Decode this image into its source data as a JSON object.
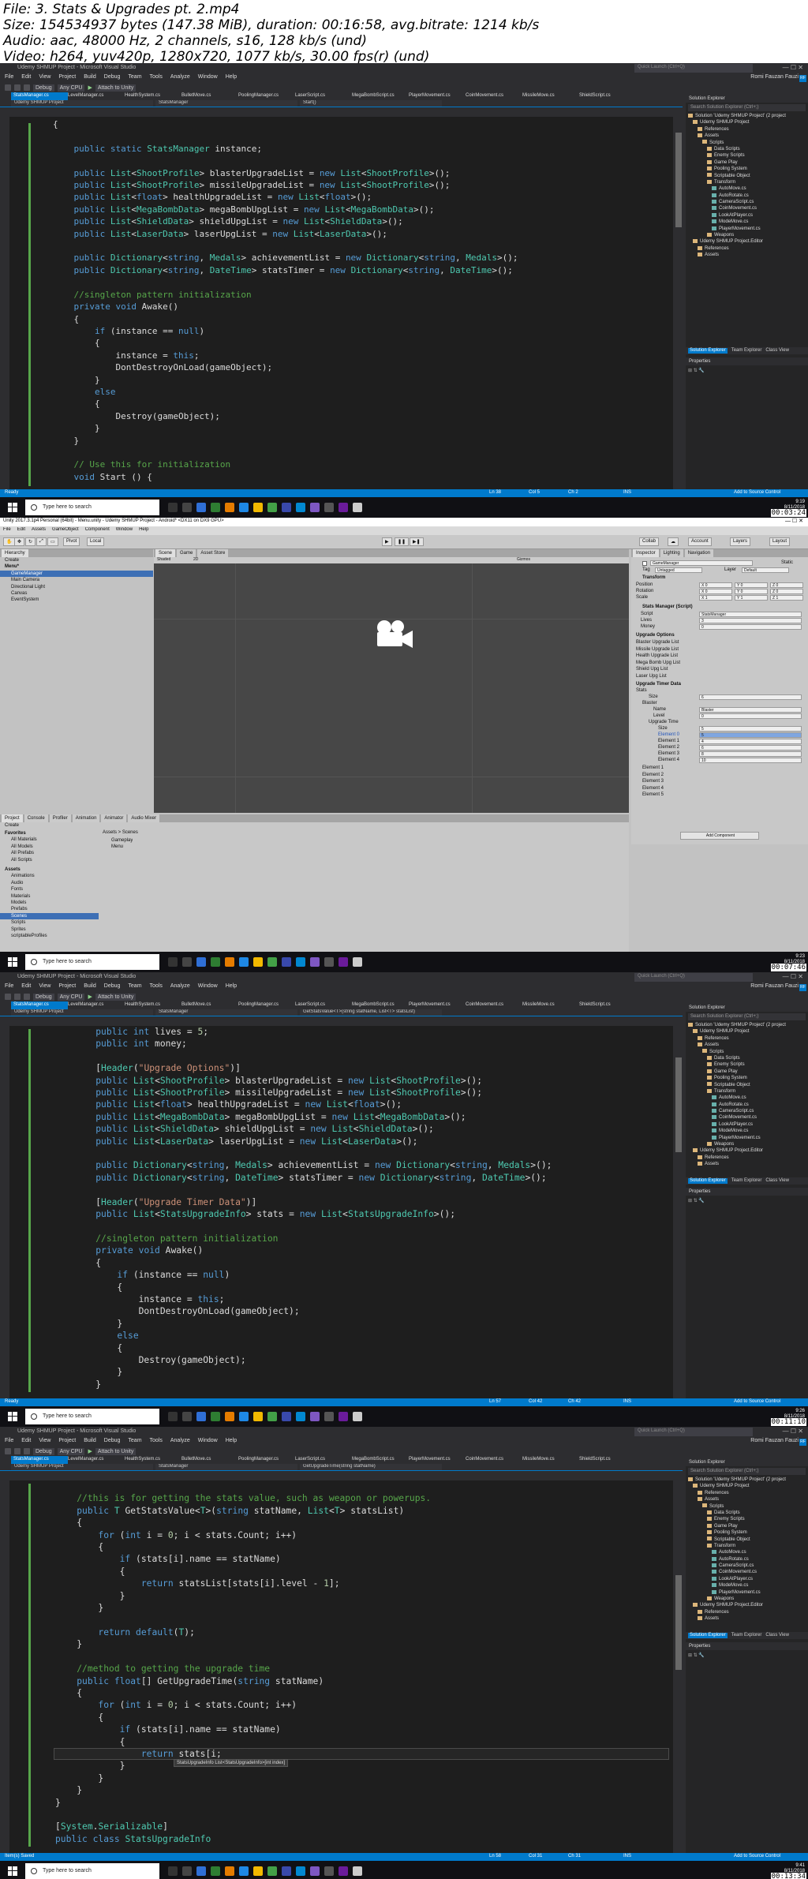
{
  "header": {
    "file": "File: 3. Stats & Upgrades pt. 2.mp4",
    "size": "Size: 154534937 bytes (147.38 MiB), duration: 00:16:58, avg.bitrate: 1214 kb/s",
    "audio": "Audio: aac, 48000 Hz, 2 channels, s16, 128 kb/s (und)",
    "video": "Video: h264, yuv420p, 1280x720, 1077 kb/s, 30.00 fps(r) (und)"
  },
  "vs": {
    "window_title": "Udemy SHMUP Project - Microsoft Visual Studio",
    "quick_launch": "Quick Launch (Ctrl+Q)",
    "user": "Romi Fauzan Fauzi",
    "user_initials": "RF",
    "menu": [
      "File",
      "Edit",
      "View",
      "Project",
      "Build",
      "Debug",
      "Team",
      "Tools",
      "Analyze",
      "Window",
      "Help"
    ],
    "toolbar": {
      "config": "Debug",
      "platform": "Any CPU",
      "attach": "Attach to Unity"
    },
    "tabs": [
      "StatsManager.cs",
      "LevelManager.cs",
      "HealthSystem.cs",
      "BulletMove.cs",
      "PoolingManager.cs",
      "LaserScript.cs",
      "MegaBombScript.cs",
      "PlayerMovement.cs",
      "CoinMovement.cs",
      "MissileMove.cs",
      "ShieldScript.cs"
    ],
    "nav_project": "Udemy SHMUP Project",
    "nav_class": "StatsManager",
    "solution": {
      "title": "Solution Explorer",
      "search": "Search Solution Explorer (Ctrl+;)",
      "items": [
        "Solution 'Udemy SHMUP Project' (2 project",
        "Udemy SHMUP Project",
        "References",
        "Assets",
        "Scripts",
        "Data Scripts",
        "Enemy Scripts",
        "Game Play",
        "Pooling System",
        "Scriptable Object",
        "Transform",
        "AutoMove.cs",
        "AutoRotate.cs",
        "CameraScript.cs",
        "CoinMovement.cs",
        "LookAtPlayer.cs",
        "ModeMove.cs",
        "PlayerMovement.cs",
        "Weapons",
        "Udemy SHMUP Project.Editor",
        "References",
        "Assets"
      ],
      "bottom_tabs": [
        "Solution Explorer",
        "Team Explorer",
        "Class View"
      ],
      "properties": "Properties"
    },
    "status_ready": "Ready",
    "status_add": "Add to Source Control"
  },
  "frame1": {
    "status": {
      "ln": "Ln 38",
      "col": "Col 5",
      "ch": "Ch 2",
      "ins": "INS",
      "zoom": "173 %"
    },
    "nav_member": "Start()",
    "lines": [
      "{",
      "",
      "    public static StatsManager instance;",
      "",
      "    public List<ShootProfile> blasterUpgradeList = new List<ShootProfile>();",
      "    public List<ShootProfile> missileUpgradeList = new List<ShootProfile>();",
      "    public List<float> healthUpgradeList = new List<float>();",
      "    public List<MegaBombData> megaBombUpgList = new List<MegaBombData>();",
      "    public List<ShieldData> shieldUpgList = new List<ShieldData>();",
      "    public List<LaserData> laserUpgList = new List<LaserData>();",
      "",
      "    public Dictionary<string, Medals> achievementList = new Dictionary<string, Medals>();",
      "    public Dictionary<string, DateTime> statsTimer = new Dictionary<string, DateTime>();",
      "",
      "    //singleton pattern initialization",
      "    private void Awake()",
      "    {",
      "        if (instance == null)",
      "        {",
      "            instance = this;",
      "            DontDestroyOnLoad(gameObject);",
      "        }",
      "        else",
      "        {",
      "            Destroy(gameObject);",
      "        }",
      "    }",
      "",
      "    // Use this for initialization",
      "    void Start () {"
    ],
    "stamp": "00:03:24",
    "clock": "9:19\n8/11/2018"
  },
  "unity": {
    "title": "Unity 2017.3.1p4 Personal (64bit) - Menu.unity - Udemy SHMUP Project - Android* <DX11 on DX9 GPU>",
    "menu": [
      "File",
      "Edit",
      "Assets",
      "GameObject",
      "Component",
      "Window",
      "Help"
    ],
    "toolbar": {
      "pivot": "Pivot",
      "local": "Local",
      "collab": "Collab",
      "account": "Account",
      "layers": "Layers",
      "layout": "Layout"
    },
    "hierarchy_tab": "Hierarchy",
    "create": "Create",
    "hierarchy": [
      "Menu*",
      "GameManager",
      "Main Camera",
      "Directional Light",
      "Canvas",
      "EventSystem"
    ],
    "scene_tabs": [
      "Scene",
      "Game",
      "Asset Store"
    ],
    "scene_bar": {
      "shaded": "Shaded",
      "mode2d": "2D",
      "gizmos": "Gizmos"
    },
    "inspector_tabs": [
      "Inspector",
      "Lighting",
      "Navigation"
    ],
    "object_name": "GameManager",
    "static": "Static",
    "tag": "Tag",
    "tag_value": "Untagged",
    "layer": "Layer",
    "layer_value": "Default",
    "transform": "Transform",
    "position": "Position",
    "rotation": "Rotation",
    "scale": "Scale",
    "pos": [
      "X 0",
      "Y 0",
      "Z 0"
    ],
    "rot": [
      "X 0",
      "Y 0",
      "Z 0"
    ],
    "scl": [
      "X 1",
      "Y 1",
      "Z 1"
    ],
    "component": "Stats Manager (Script)",
    "script": "Script",
    "script_value": "StatsManager",
    "lives": "Lives",
    "lives_value": "3",
    "money": "Money",
    "money_value": "0",
    "upgrade_options": "Upgrade Options",
    "lists": [
      "Blaster Upgrade List",
      "Missile Upgrade List",
      "Health Upgrade List",
      "Mega Bomb Upg List",
      "Shield Upg List",
      "Laser Upg List"
    ],
    "timer_header": "Upgrade Timer Data",
    "stats": "Stats",
    "size": "Size",
    "size_value": "6",
    "blaster": "Blaster",
    "name": "Name",
    "name_value": "Blaster",
    "level": "Level",
    "level_value": "0",
    "upgrade_time": "Upgrade Time",
    "ut_size": "Size",
    "ut_size_value": "5",
    "ut_elements": [
      [
        "Element 0",
        "5"
      ],
      [
        "Element 1",
        "4"
      ],
      [
        "Element 2",
        "6"
      ],
      [
        "Element 3",
        "8"
      ],
      [
        "Element 4",
        "10"
      ]
    ],
    "more_elements": [
      "Element 1",
      "Element 2",
      "Element 3",
      "Element 4",
      "Element 5"
    ],
    "add_component": "Add Component",
    "project_tabs": [
      "Project",
      "Console",
      "Profiler",
      "Animation",
      "Animator",
      "Audio Mixer"
    ],
    "favorites": [
      "Favorites",
      "All Materials",
      "All Models",
      "All Prefabs",
      "All Scripts"
    ],
    "assets_tree": [
      "Assets",
      "Animations",
      "Audio",
      "Fonts",
      "Materials",
      "Models",
      "Prefabs",
      "Scenes",
      "Scripts",
      "Sprites",
      "scriptableProfiles"
    ],
    "breadcrumb": "Assets > Scenes",
    "scene_files": [
      "Gameplay",
      "Menu"
    ],
    "stamp": "00:07:46",
    "clock": "9:23\n8/11/2018"
  },
  "frame3": {
    "status": {
      "ln": "Ln 57",
      "col": "Col 42",
      "ch": "Ch 42",
      "ins": "INS",
      "zoom": "173 %"
    },
    "nav_member": "GetStatsValue<T>(string statName, List<T> statsList)",
    "lines": [
      "    public int lives = 5;",
      "    public int money;",
      "",
      "    [Header(\"Upgrade Options\")]",
      "    public List<ShootProfile> blasterUpgradeList = new List<ShootProfile>();",
      "    public List<ShootProfile> missileUpgradeList = new List<ShootProfile>();",
      "    public List<float> healthUpgradeList = new List<float>();",
      "    public List<MegaBombData> megaBombUpgList = new List<MegaBombData>();",
      "    public List<ShieldData> shieldUpgList = new List<ShieldData>();",
      "    public List<LaserData> laserUpgList = new List<LaserData>();",
      "",
      "    public Dictionary<string, Medals> achievementList = new Dictionary<string, Medals>();",
      "    public Dictionary<string, DateTime> statsTimer = new Dictionary<string, DateTime>();",
      "",
      "    [Header(\"Upgrade Timer Data\")]",
      "    public List<StatsUpgradeInfo> stats = new List<StatsUpgradeInfo>();",
      "",
      "    //singleton pattern initialization",
      "    private void Awake()",
      "    {",
      "        if (instance == null)",
      "        {",
      "            instance = this;",
      "            DontDestroyOnLoad(gameObject);",
      "        }",
      "        else",
      "        {",
      "            Destroy(gameObject);",
      "        }",
      "    }"
    ],
    "stamp": "00:11:10",
    "clock": "9:26\n8/11/2018"
  },
  "frame4": {
    "status": {
      "ln": "Ln 58",
      "col": "Col 31",
      "ch": "Ch 31",
      "ins": "INS",
      "zoom": "173 %",
      "left": "Item(s) Saved"
    },
    "nav_member": "GetUpgradeTime(string statName)",
    "tooltip": "StatsUpgradeInfo List<StatsUpgradeInfo>[int index]",
    "lines": [
      "",
      "    //this is for getting the stats value, such as weapon or powerups.",
      "    public T GetStatsValue<T>(string statName, List<T> statsList)",
      "    {",
      "        for (int i = 0; i < stats.Count; i++)",
      "        {",
      "            if (stats[i].name == statName)",
      "            {",
      "                return statsList[stats[i].level - 1];",
      "            }",
      "        }",
      "",
      "        return default(T);",
      "    }",
      "",
      "    //method to getting the upgrade time",
      "    public float[] GetUpgradeTime(string statName)",
      "    {",
      "        for (int i = 0; i < stats.Count; i++)",
      "        {",
      "            if (stats[i].name == statName)",
      "            {",
      "                return stats[i;",
      "            }",
      "        }",
      "    }",
      "}",
      "",
      "[System.Serializable]",
      "public class StatsUpgradeInfo"
    ],
    "stamp": "00:13:34",
    "clock": "9:41\n8/11/2018"
  },
  "taskbar": {
    "search": "Type here to search"
  }
}
